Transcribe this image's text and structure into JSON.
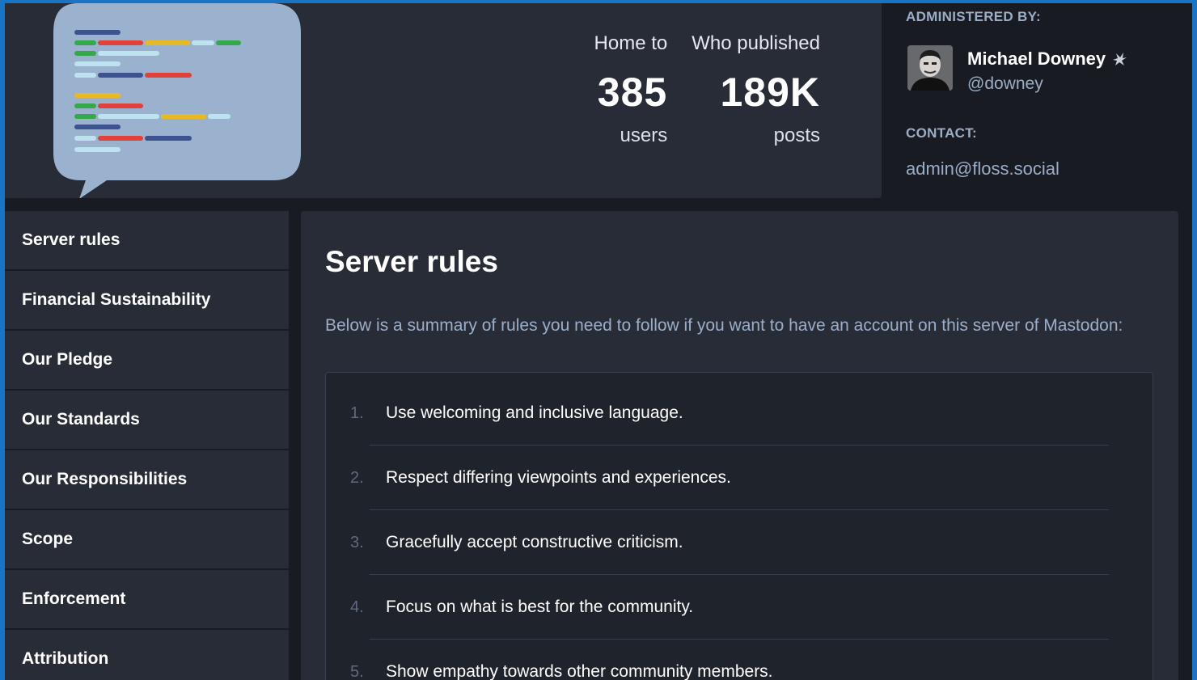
{
  "hero": {
    "stats": [
      {
        "label": "Home to",
        "value": "385",
        "unit": "users"
      },
      {
        "label": "Who published",
        "value": "189K",
        "unit": "posts"
      }
    ]
  },
  "info": {
    "admin_label": "ADMINISTERED BY:",
    "admin_name": "Michael Downey",
    "admin_handle": "@downey",
    "contact_label": "CONTACT:",
    "contact_email": "admin@floss.social"
  },
  "sidebar": {
    "items": [
      {
        "label": "Server rules"
      },
      {
        "label": "Financial Sustainability"
      },
      {
        "label": "Our Pledge"
      },
      {
        "label": "Our Standards"
      },
      {
        "label": "Our Responsibilities"
      },
      {
        "label": "Scope"
      },
      {
        "label": "Enforcement"
      },
      {
        "label": "Attribution"
      }
    ]
  },
  "main": {
    "title": "Server rules",
    "description": "Below is a summary of rules you need to follow if you want to have an account on this server of Mastodon:",
    "rules": [
      {
        "num": "1.",
        "text": "Use welcoming and inclusive language."
      },
      {
        "num": "2.",
        "text": "Respect differing viewpoints and experiences."
      },
      {
        "num": "3.",
        "text": "Gracefully accept constructive criticism."
      },
      {
        "num": "4.",
        "text": "Focus on what is best for the community."
      },
      {
        "num": "5.",
        "text": "Show empathy towards other community members."
      }
    ]
  },
  "colors": {
    "background": "#191b22",
    "panel": "#282c37",
    "accent_frame": "#1a74c4",
    "secondary_text": "#9baec8"
  }
}
